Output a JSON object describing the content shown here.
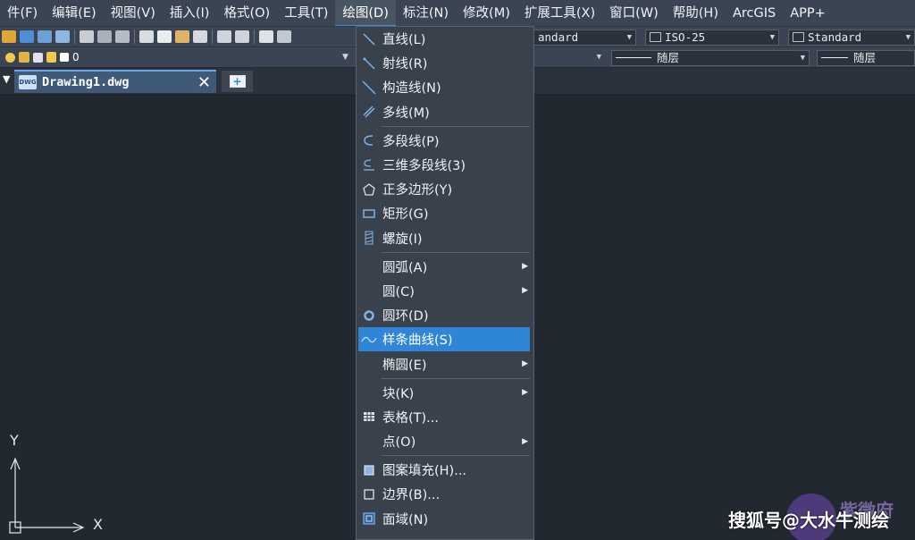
{
  "menubar": {
    "items": [
      "件(F)",
      "编辑(E)",
      "视图(V)",
      "插入(I)",
      "格式(O)",
      "工具(T)",
      "绘图(D)",
      "标注(N)",
      "修改(M)",
      "扩展工具(X)",
      "窗口(W)",
      "帮助(H)",
      "ArcGIS",
      "APP+"
    ],
    "active_index": 6
  },
  "toolbar1": {
    "text_style": "andard",
    "dim_style": "ISO-25",
    "table_style": "Standard"
  },
  "toolbar2": {
    "layer": "0",
    "linetype": "随层",
    "lineweight": "随层"
  },
  "tabs": {
    "doc_name": "Drawing1.dwg",
    "dwg_badge": "DWG",
    "close_symbol": "✕",
    "new_symbol": "+"
  },
  "ucs": {
    "x_label": "X",
    "y_label": "Y"
  },
  "draw_menu": {
    "items": [
      {
        "label": "直线(L)",
        "icon": "line-icon",
        "submenu": false
      },
      {
        "label": "射线(R)",
        "icon": "ray-icon",
        "submenu": false
      },
      {
        "label": "构造线(N)",
        "icon": "xline-icon",
        "submenu": false
      },
      {
        "label": "多线(M)",
        "icon": "mline-icon",
        "submenu": false
      },
      {
        "label": "多段线(P)",
        "icon": "polyline-icon",
        "submenu": false
      },
      {
        "label": "三维多段线(3)",
        "icon": "3d-polyline-icon",
        "submenu": false
      },
      {
        "label": "正多边形(Y)",
        "icon": "polygon-icon",
        "submenu": false
      },
      {
        "label": "矩形(G)",
        "icon": "rectangle-icon",
        "submenu": false
      },
      {
        "label": "螺旋(I)",
        "icon": "helix-icon",
        "submenu": false
      },
      {
        "label": "圆弧(A)",
        "icon": "",
        "submenu": true
      },
      {
        "label": "圆(C)",
        "icon": "",
        "submenu": true
      },
      {
        "label": "圆环(D)",
        "icon": "donut-icon",
        "submenu": false
      },
      {
        "label": "样条曲线(S)",
        "icon": "spline-icon",
        "submenu": false,
        "highlighted": true
      },
      {
        "label": "椭圆(E)",
        "icon": "",
        "submenu": true
      },
      {
        "label": "块(K)",
        "icon": "",
        "submenu": true
      },
      {
        "label": "表格(T)...",
        "icon": "table-icon",
        "submenu": false
      },
      {
        "label": "点(O)",
        "icon": "",
        "submenu": true
      },
      {
        "label": "图案填充(H)...",
        "icon": "hatch-icon",
        "submenu": false
      },
      {
        "label": "边界(B)...",
        "icon": "boundary-icon",
        "submenu": false
      },
      {
        "label": "面域(N)",
        "icon": "region-icon",
        "submenu": false
      }
    ]
  },
  "watermark": {
    "text": "搜狐号@大水牛测绘",
    "logo_text": "紫微府"
  },
  "colors": {
    "menubar": "#3b4453",
    "canvas": "#212830",
    "highlight": "#2f86d8",
    "tab": "#3e5a78"
  }
}
